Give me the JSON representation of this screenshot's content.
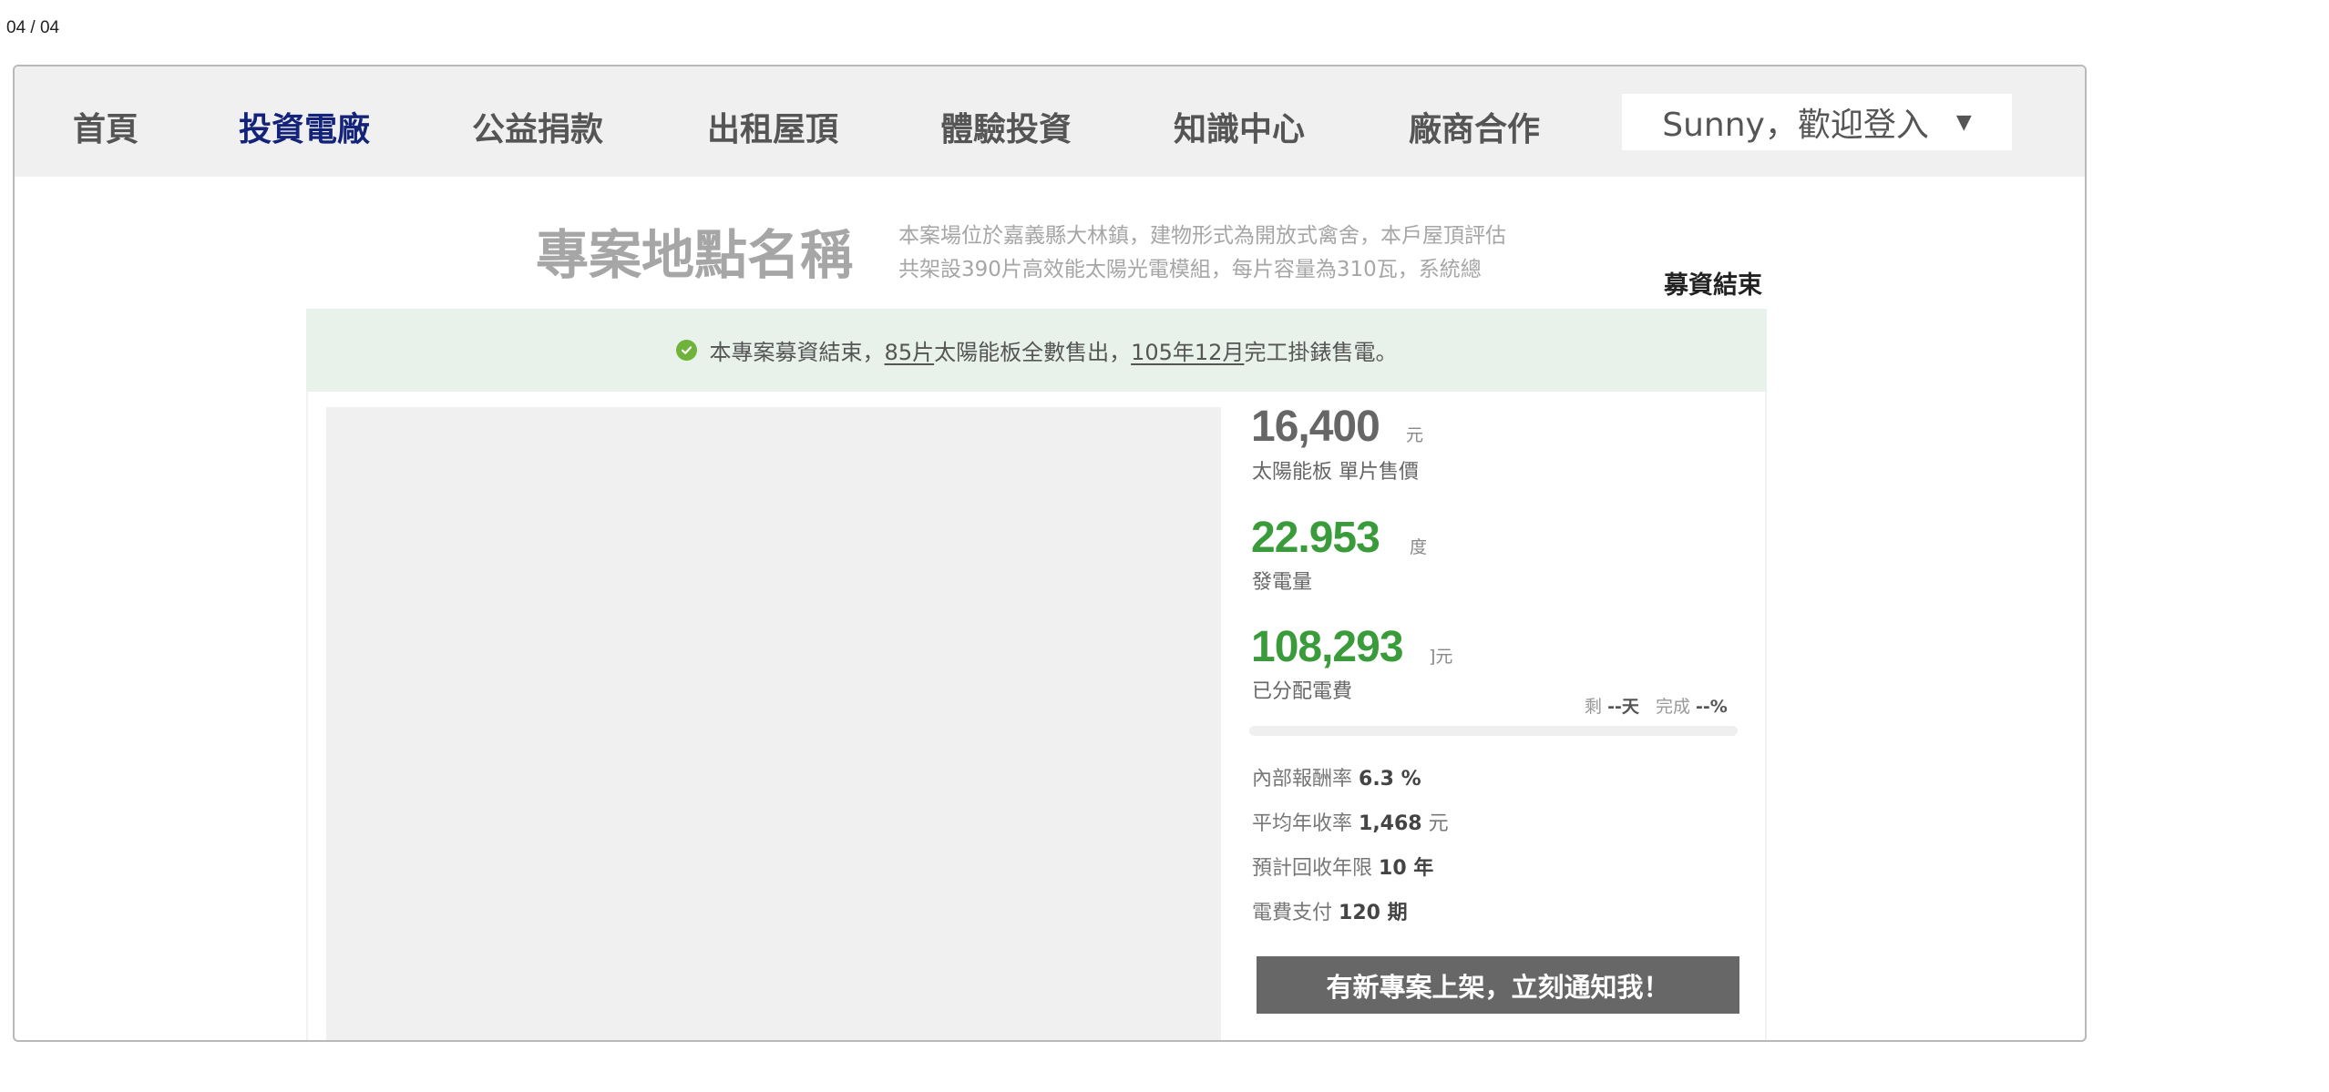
{
  "page_counter": "04 / 04",
  "nav": {
    "items": [
      {
        "label": "首頁"
      },
      {
        "label": "投資電廠"
      },
      {
        "label": "公益捐款"
      },
      {
        "label": "出租屋頂"
      },
      {
        "label": "體驗投資"
      },
      {
        "label": "知識中心"
      },
      {
        "label": "廠商合作"
      }
    ],
    "user_menu": "Sunny，歡迎登入",
    "active_color": "#14237a"
  },
  "project": {
    "title": "專案地點名稱",
    "description_line1": "本案場位於嘉義縣大林鎮，建物形式為開放式禽舍，本戶屋頂評估",
    "description_line2": "共架設390片高效能太陽光電模組，每片容量為310瓦，系統總",
    "status_tag": "募資結束"
  },
  "banner": {
    "text_before": "本專案募資結束，",
    "panels": "85片",
    "text_middle": "太陽能板全數售出，",
    "completion": "105年12月",
    "text_after": "完工掛錶售電。"
  },
  "stats": {
    "price": {
      "value": "16,400",
      "unit": "元",
      "label": "太陽能板 單片售價"
    },
    "generation": {
      "value": "22.953",
      "unit": "度",
      "label": "發電量"
    },
    "distributed": {
      "value": "108,293",
      "unit": "]元",
      "label": "已分配電費"
    }
  },
  "progress": {
    "remain_label": "剩",
    "remain_value": "--天",
    "complete_label": "完成",
    "complete_value": "--%"
  },
  "details": [
    {
      "label": "內部報酬率",
      "value": "6.3 %"
    },
    {
      "label": "平均年收率",
      "value": "1,468",
      "unit": "元"
    },
    {
      "label": "預計回收年限",
      "value": "10 年"
    },
    {
      "label": "電費支付",
      "value": "120 期"
    }
  ],
  "notify_button": "有新專案上架，立刻通知我！",
  "colors": {
    "accent_green": "#3a9b3a",
    "banner_bg": "#e8f1ea",
    "button_bg": "#676767"
  }
}
